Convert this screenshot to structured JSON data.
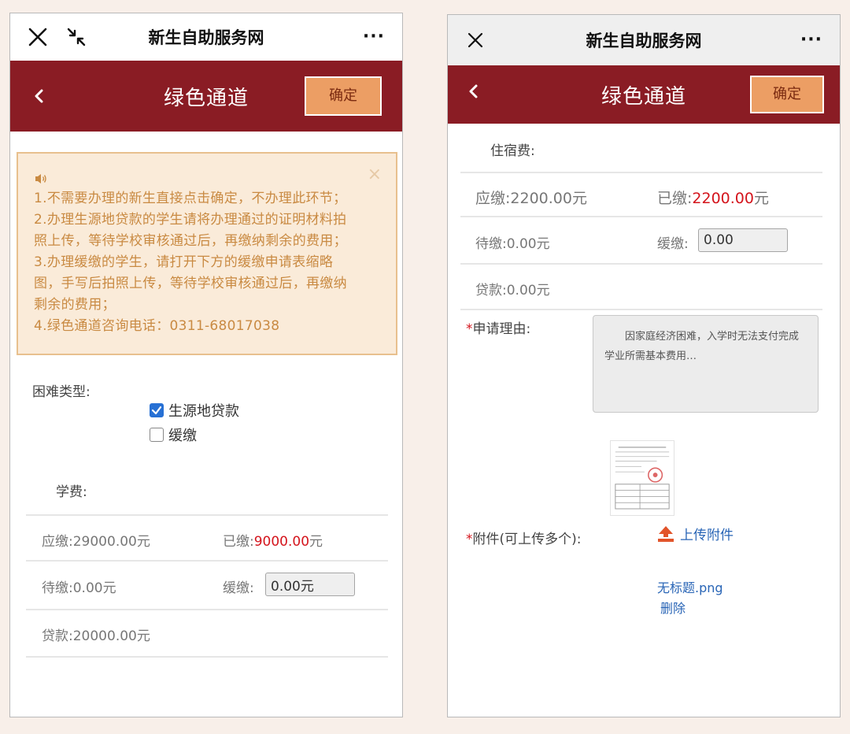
{
  "wechat": {
    "title": "新生自助服务网",
    "more_label": "···"
  },
  "header": {
    "title": "绿色通道",
    "confirm_label": "确定"
  },
  "notice": {
    "close_label": "×",
    "lines": [
      "1.不需要办理的新生直接点击确定，不办理此环节；",
      "2.办理生源地贷款的学生请将办理通过的证明材料拍",
      "照上传，等待学校审核通过后，再缴纳剩余的费用；",
      "3.办理缓缴的学生，请打开下方的缓缴申请表缩略",
      "图，手写后拍照上传，等待学校审核通过后，再缴纳",
      "剩余的费用；",
      "4.绿色通道咨询电话：0311-68017038"
    ]
  },
  "left_form": {
    "difficulty_label": "困难类型:",
    "options": [
      {
        "label": "生源地贷款",
        "checked": true
      },
      {
        "label": "缓缴",
        "checked": false
      }
    ],
    "tuition_label": "学费:",
    "due_label": "应缴:",
    "due_value": "29000.00元",
    "paid_label": "已缴:",
    "paid_amount": "9000.00",
    "paid_unit": "元",
    "pending_label": "待缴:",
    "pending_value": "0.00元",
    "defer_label": "缓缴:",
    "defer_value": "0.00元",
    "loan_label": "贷款:",
    "loan_value": "20000.00元"
  },
  "right_form": {
    "lodging_label": "住宿费:",
    "due_label": "应缴:",
    "due_value": "2200.00元",
    "paid_label": "已缴:",
    "paid_amount": "2200.00",
    "paid_unit": "元",
    "pending_label": "待缴:",
    "pending_value": "0.00元",
    "defer_label": "缓缴:",
    "defer_value": "0.00",
    "loan_label": "贷款:",
    "loan_value": "0.00元",
    "required_mark": "*",
    "reason_label": "申请理由:",
    "reason_text": "因家庭经济困难，入学时无法支付完成学业所需基本费用…",
    "attach_label": "附件(可上传多个):",
    "upload_label": "上传附件",
    "file_name": "无标题.png",
    "delete_label": "删除"
  },
  "colors": {
    "header_bg": "#8a1c24",
    "confirm_bg": "#ec9e64",
    "notice_bg": "#faebd9",
    "notice_text": "#c98a42",
    "paid_red": "#d4141c",
    "link_blue": "#2965b6"
  },
  "icons": [
    "close-icon",
    "shrink-icon",
    "more-icon",
    "back-icon",
    "speaker-icon",
    "checkmark-icon",
    "upload-icon"
  ]
}
